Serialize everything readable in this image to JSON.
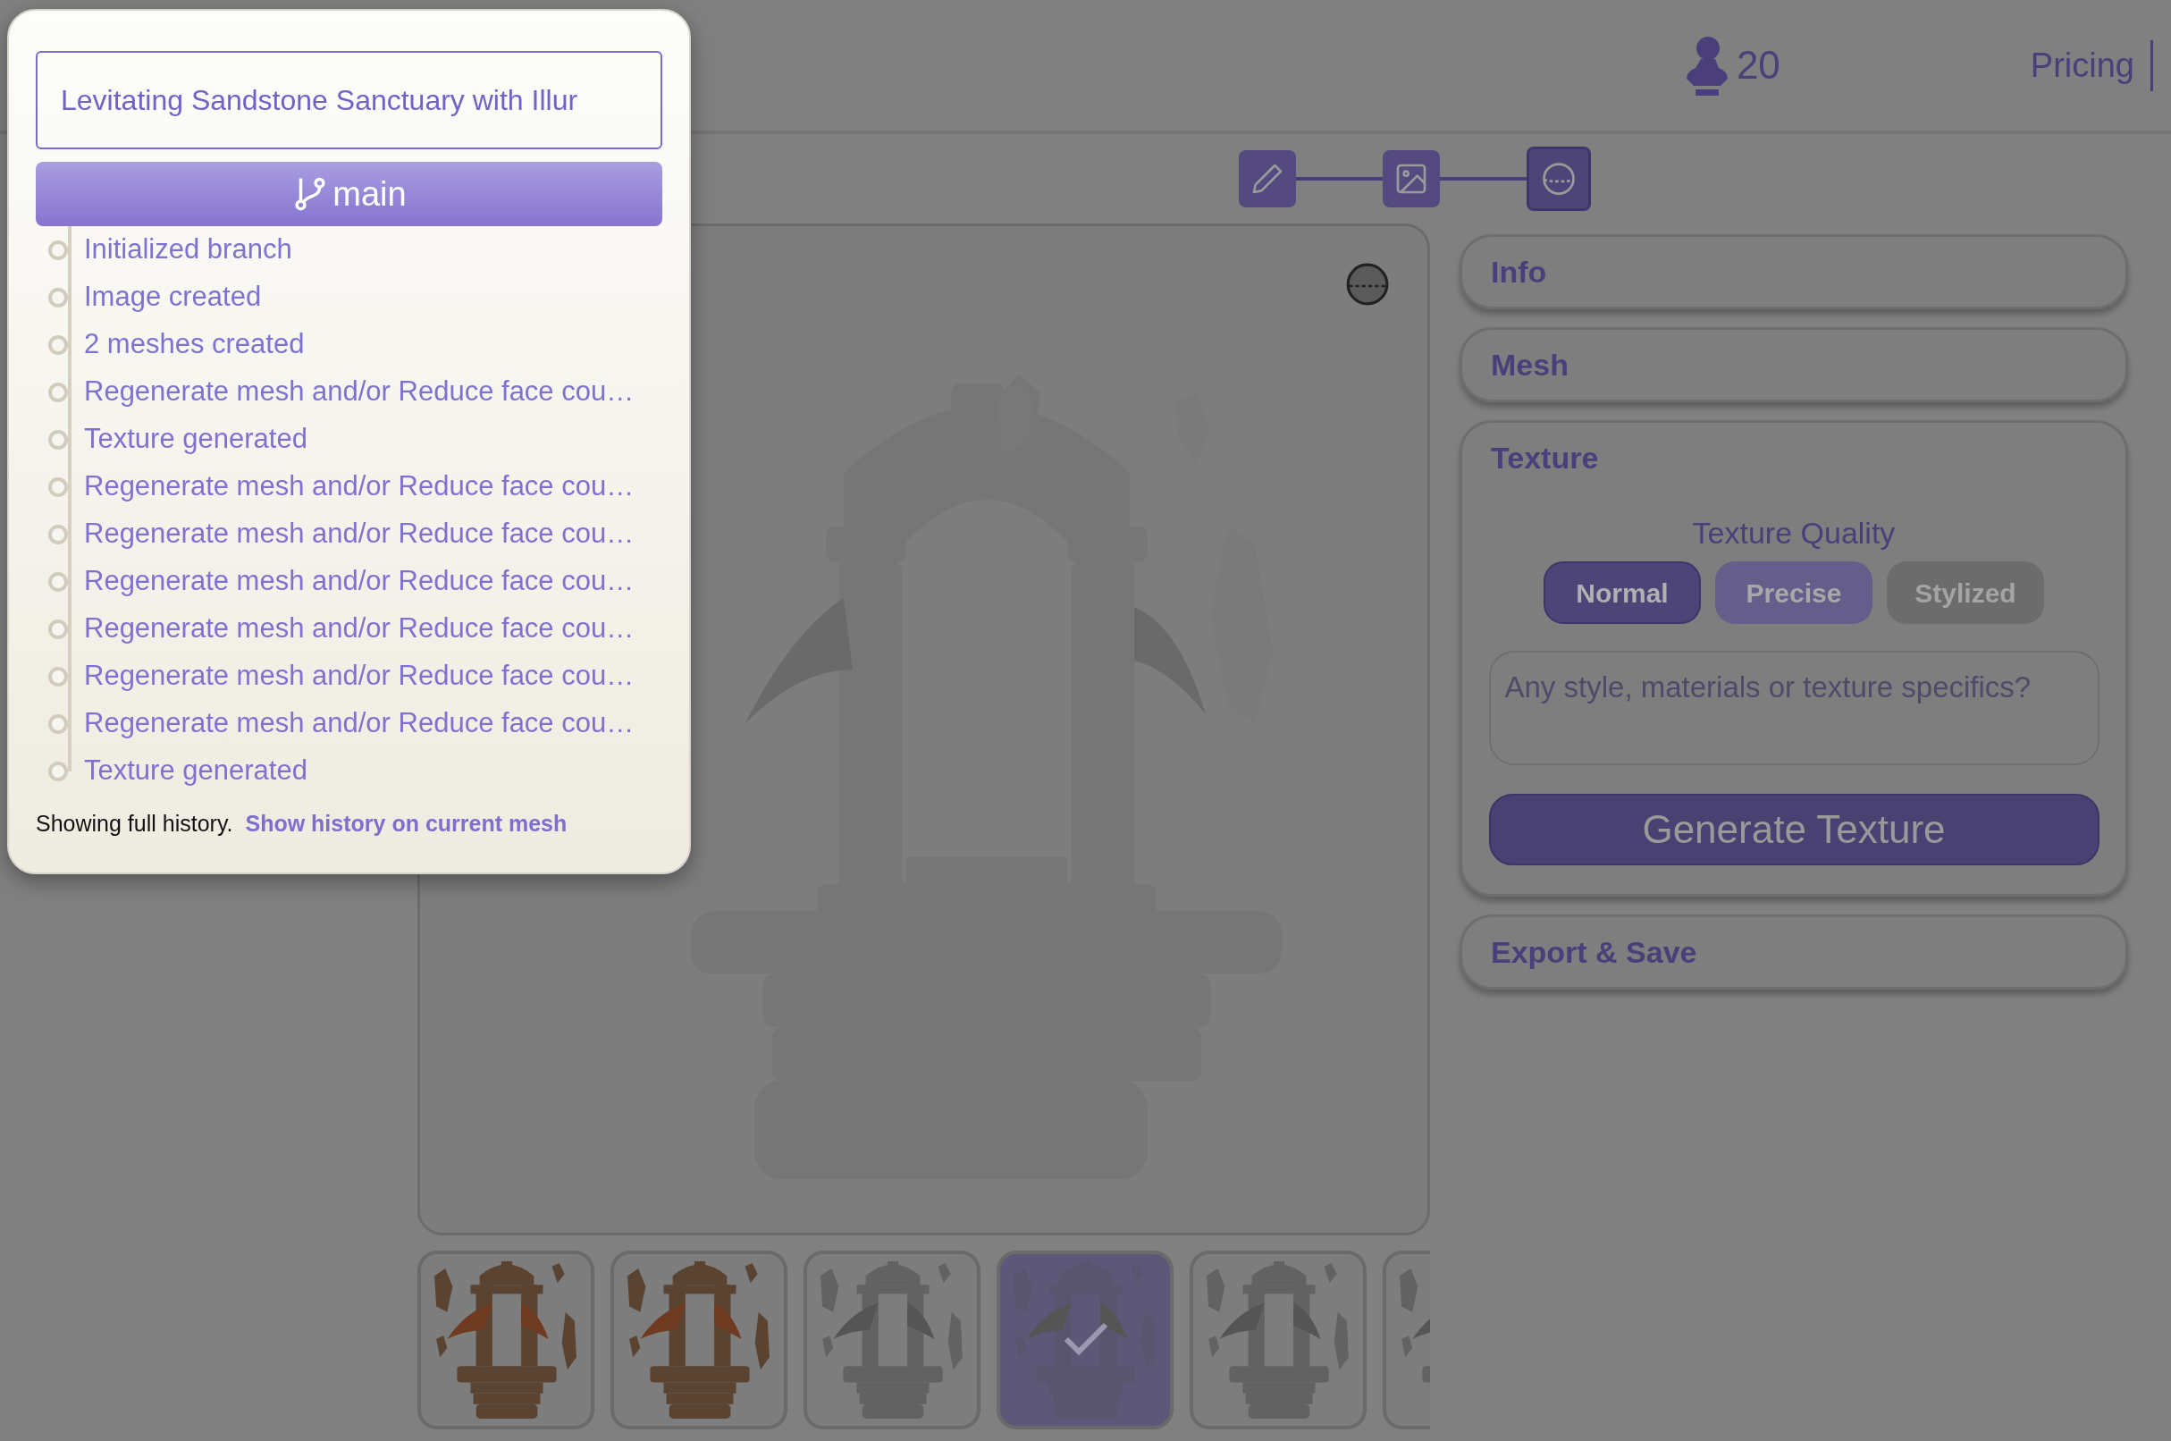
{
  "header": {
    "credits": "20",
    "nav": [
      {
        "label": "Pricing"
      }
    ]
  },
  "steps": [
    {
      "kind": "prompt",
      "selected": false
    },
    {
      "kind": "image",
      "selected": false
    },
    {
      "kind": "mesh",
      "selected": true
    }
  ],
  "viewer": {
    "thumbnails": [
      {
        "textured": true,
        "selected": false
      },
      {
        "textured": true,
        "selected": false
      },
      {
        "textured": false,
        "selected": false
      },
      {
        "textured": false,
        "selected": true
      },
      {
        "textured": false,
        "selected": false
      },
      {
        "textured": false,
        "selected": false
      }
    ]
  },
  "panel": {
    "sections": [
      {
        "title": "Info",
        "expanded": false
      },
      {
        "title": "Mesh",
        "expanded": false
      },
      {
        "title": "Texture",
        "expanded": true
      },
      {
        "title": "Export & Save",
        "expanded": false
      }
    ],
    "texture": {
      "quality_label": "Texture Quality",
      "options": [
        {
          "label": "Normal",
          "selected": true,
          "disabled": false
        },
        {
          "label": "Precise",
          "selected": false,
          "disabled": false
        },
        {
          "label": "Stylized",
          "selected": false,
          "disabled": true
        }
      ],
      "placeholder": "Any style, materials or texture specifics?",
      "button": "Generate Texture"
    }
  },
  "history_popup": {
    "title": "Levitating Sandstone Sanctuary with Illur",
    "branch": "main",
    "items": [
      {
        "text": "Initialized branch"
      },
      {
        "text": "Image created"
      },
      {
        "text": "2 meshes created"
      },
      {
        "text": "Regenerate mesh and/or Reduce face cou…"
      },
      {
        "text": "Texture generated"
      },
      {
        "text": "Regenerate mesh and/or Reduce face cou…"
      },
      {
        "text": "Regenerate mesh and/or Reduce face cou…"
      },
      {
        "text": "Regenerate mesh and/or Reduce face cou…"
      },
      {
        "text": "Regenerate mesh and/or Reduce face cou…"
      },
      {
        "text": "Regenerate mesh and/or Reduce face cou…"
      },
      {
        "text": "Regenerate mesh and/or Reduce face cou…"
      },
      {
        "text": "Texture generated"
      }
    ],
    "footer_text": "Showing full history.",
    "footer_link": "Show history on current mesh"
  }
}
